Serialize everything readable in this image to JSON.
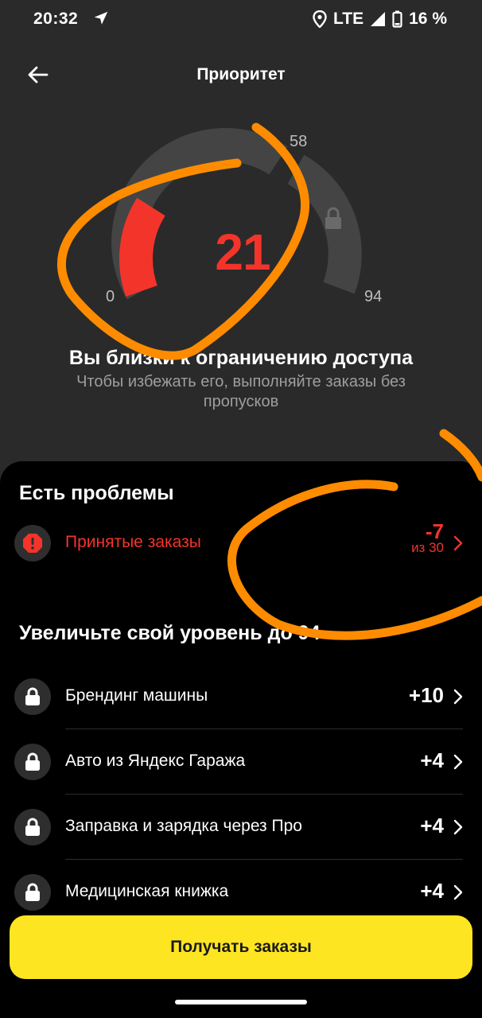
{
  "status": {
    "time": "20:32",
    "network": "LTE",
    "battery": "16 %"
  },
  "header": {
    "title": "Приоритет"
  },
  "gauge": {
    "min": "0",
    "mid": "58",
    "max": "94",
    "value": "21",
    "value_number": 21
  },
  "message": {
    "headline": "Вы близки к ограничению доступа",
    "subline": "Чтобы избежать его, выполняйте заказы без пропусков"
  },
  "problems": {
    "title": "Есть проблемы",
    "items": [
      {
        "label": "Принятые заказы",
        "value": "-7",
        "sub": "из 30"
      }
    ]
  },
  "improve": {
    "title": "Увеличьте свой уровень до 94",
    "items": [
      {
        "label": "Брендинг машины",
        "value": "+10"
      },
      {
        "label": "Авто из Яндекс Гаража",
        "value": "+4"
      },
      {
        "label": "Заправка и зарядка через Про",
        "value": "+4"
      },
      {
        "label": "Медицинская книжка",
        "value": "+4"
      }
    ]
  },
  "cta": {
    "label": "Получать заказы"
  },
  "colors": {
    "accent_red": "#f3342b",
    "cta_yellow": "#fde521",
    "annotation_orange": "#ff8c00"
  }
}
